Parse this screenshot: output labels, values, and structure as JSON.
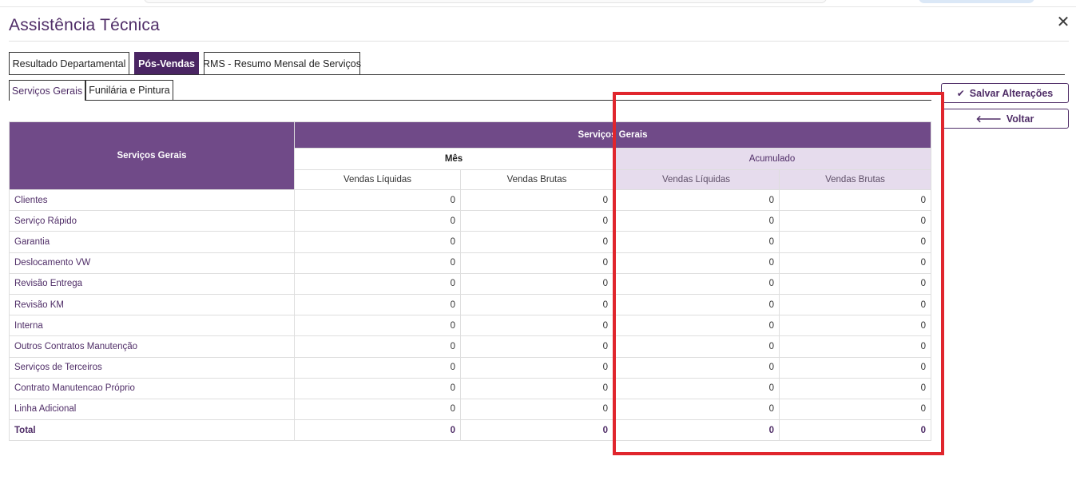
{
  "title": "Assistência Técnica",
  "close_symbol": "✕",
  "main_tabs": [
    {
      "label": "Resultado Departamental"
    },
    {
      "label": "Pós-Vendas"
    },
    {
      "label": "RMS - Resumo Mensal de Serviços"
    }
  ],
  "sub_tabs": [
    {
      "label": "Serviços Gerais"
    },
    {
      "label": "Funilária e Pintura"
    }
  ],
  "buttons": {
    "save": {
      "label": "Salvar Alterações",
      "icon": "✔"
    },
    "back": {
      "label": "Voltar",
      "icon": "🡐"
    }
  },
  "table": {
    "row_header": "Serviços Gerais",
    "group_header": "Serviços Gerais",
    "mes_header": "Mês",
    "acumulado_header": "Acumulado",
    "col_headers": [
      "Vendas Líquidas",
      "Vendas Brutas",
      "Vendas Líquidas",
      "Vendas Brutas"
    ],
    "rows": [
      {
        "label": "Clientes",
        "values": [
          "0",
          "0",
          "0",
          "0"
        ]
      },
      {
        "label": "Serviço Rápido",
        "values": [
          "0",
          "0",
          "0",
          "0"
        ]
      },
      {
        "label": "Garantia",
        "values": [
          "0",
          "0",
          "0",
          "0"
        ]
      },
      {
        "label": "Deslocamento VW",
        "values": [
          "0",
          "0",
          "0",
          "0"
        ]
      },
      {
        "label": "Revisão Entrega",
        "values": [
          "0",
          "0",
          "0",
          "0"
        ]
      },
      {
        "label": "Revisão KM",
        "values": [
          "0",
          "0",
          "0",
          "0"
        ]
      },
      {
        "label": "Interna",
        "values": [
          "0",
          "0",
          "0",
          "0"
        ]
      },
      {
        "label": "Outros Contratos Manutenção",
        "values": [
          "0",
          "0",
          "0",
          "0"
        ]
      },
      {
        "label": "Serviços de Terceiros",
        "values": [
          "0",
          "0",
          "0",
          "0"
        ]
      },
      {
        "label": "Contrato Manutencao Próprio",
        "values": [
          "0",
          "0",
          "0",
          "0"
        ]
      },
      {
        "label": "Linha Adicional",
        "values": [
          "0",
          "0",
          "0",
          "0"
        ]
      }
    ],
    "total": {
      "label": "Total",
      "values": [
        "0",
        "0",
        "0",
        "0"
      ]
    }
  },
  "colors": {
    "brand": "#4f2d67",
    "header_bg": "#704a88",
    "accum_bg": "#e6dced",
    "highlight": "#e0262d"
  }
}
